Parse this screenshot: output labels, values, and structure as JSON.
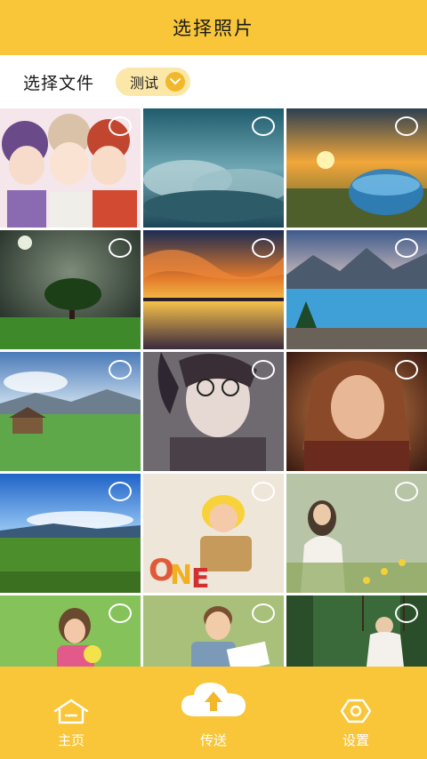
{
  "header": {
    "title": "选择照片"
  },
  "toolbar": {
    "label": "选择文件",
    "folder_selected": "测试"
  },
  "photos": [
    {
      "desc": "anime-girls"
    },
    {
      "desc": "cloud-sky"
    },
    {
      "desc": "bottle-sunset"
    },
    {
      "desc": "lone-tree"
    },
    {
      "desc": "sunset-lake"
    },
    {
      "desc": "mountain-lake"
    },
    {
      "desc": "meadow-cabin"
    },
    {
      "desc": "anime-boy"
    },
    {
      "desc": "fire-girl"
    },
    {
      "desc": "grassland"
    },
    {
      "desc": "baby-basket"
    },
    {
      "desc": "girl-flowers"
    },
    {
      "desc": "child-flowers"
    },
    {
      "desc": "boy-book"
    },
    {
      "desc": "child-swing"
    }
  ],
  "bottom_nav": {
    "home_label": "主页",
    "upload_label": "传送",
    "settings_label": "设置"
  },
  "colors": {
    "accent": "#f9c63a",
    "accent_dark": "#f2b72a",
    "chip": "#fbe7a8"
  }
}
